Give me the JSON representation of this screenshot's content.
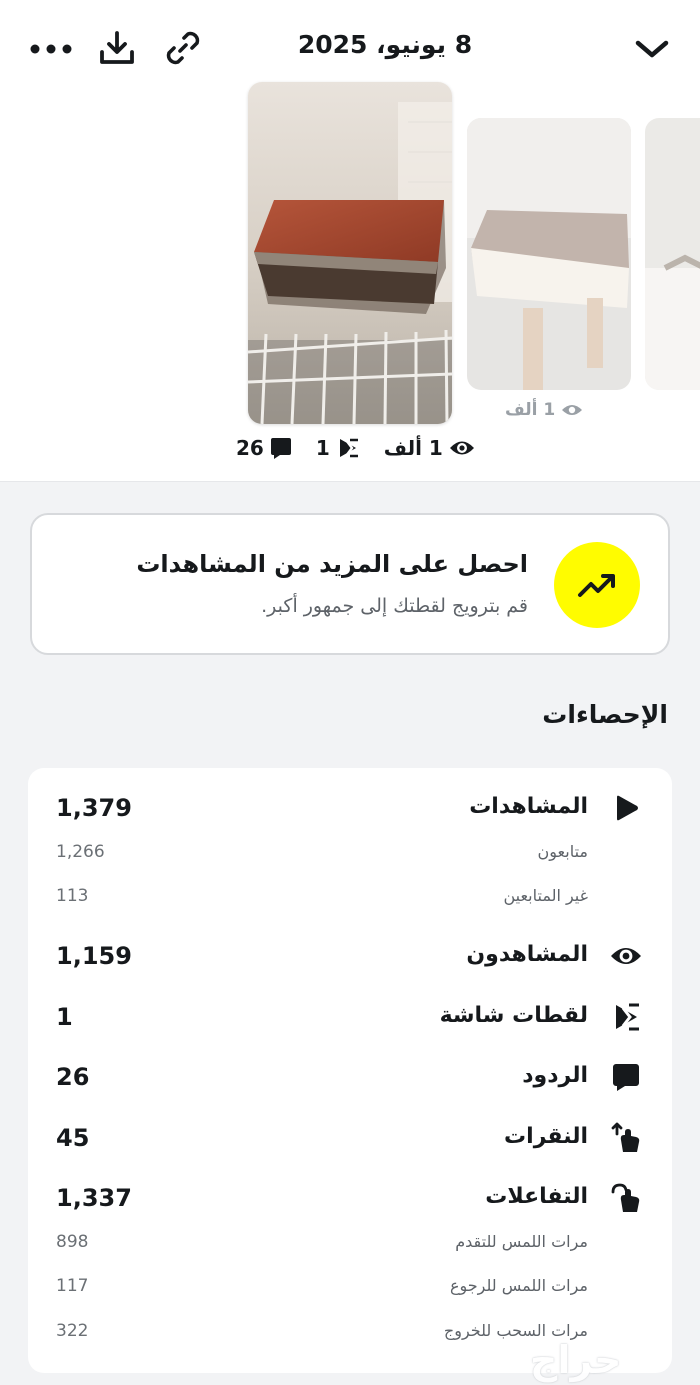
{
  "header": {
    "date": "8 يونيو، 2025",
    "icons": [
      "chevron-down-icon",
      "link-icon",
      "download-icon",
      "more-icon"
    ]
  },
  "thumbnails": {
    "secondary_stat": {
      "views": "1 ألف",
      "icon": "eye-icon"
    }
  },
  "story_stats": {
    "views": "1 ألف",
    "screenshots": "1",
    "replies": "26"
  },
  "promo": {
    "title": "احصل على المزيد من المشاهدات",
    "subtitle": "قم بترويج لقطتك إلى جمهور أكبر.",
    "icon": "trending-up-icon",
    "accent": "#fffc00"
  },
  "stats_section": {
    "title": "الإحصاءات",
    "rows": [
      {
        "label": "المشاهدات",
        "value": "1,379",
        "icon": "play-icon",
        "sub": [
          {
            "label": "متابعون",
            "value": "1,266"
          },
          {
            "label": "غير المتابعين",
            "value": "113"
          }
        ]
      },
      {
        "label": "المشاهدون",
        "value": "1,159",
        "icon": "eye-icon"
      },
      {
        "label": "لقطات شاشة",
        "value": "1",
        "icon": "screenshot-icon"
      },
      {
        "label": "الردود",
        "value": "26",
        "icon": "reply-icon"
      },
      {
        "label": "النقرات",
        "value": "45",
        "icon": "tap-icon"
      },
      {
        "label": "التفاعلات",
        "value": "1,337",
        "icon": "interaction-icon",
        "sub": [
          {
            "label": "مرات اللمس للتقدم",
            "value": "898"
          },
          {
            "label": "مرات اللمس للرجوع",
            "value": "117"
          },
          {
            "label": "مرات السحب للخروج",
            "value": "322"
          }
        ]
      }
    ]
  },
  "watermark": "حراج"
}
